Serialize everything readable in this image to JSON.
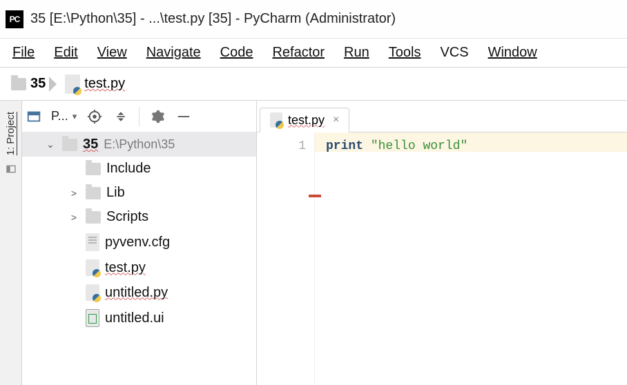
{
  "titlebar": {
    "app_icon_text": "PC",
    "title": "35 [E:\\Python\\35] - ...\\test.py [35] - PyCharm (Administrator)"
  },
  "menu": {
    "file": "File",
    "edit": "Edit",
    "view": "View",
    "navigate": "Navigate",
    "code": "Code",
    "refactor": "Refactor",
    "run": "Run",
    "tools": "Tools",
    "vcs": "VCS",
    "window": "Window"
  },
  "breadcrumb": {
    "root": "35",
    "file": "test.py"
  },
  "sidebar": {
    "label": "1: Project"
  },
  "project_panel": {
    "dropdown_label": "P...",
    "tree": {
      "root": {
        "name": "35",
        "path": "E:\\Python\\35"
      },
      "children": [
        {
          "name": "Include",
          "type": "folder",
          "expand": ""
        },
        {
          "name": "Lib",
          "type": "folder",
          "expand": ">"
        },
        {
          "name": "Scripts",
          "type": "folder",
          "expand": ">"
        },
        {
          "name": "pyvenv.cfg",
          "type": "file"
        },
        {
          "name": "test.py",
          "type": "pyfile"
        },
        {
          "name": "untitled.py",
          "type": "pyfile"
        },
        {
          "name": "untitled.ui",
          "type": "uifile"
        }
      ]
    }
  },
  "editor": {
    "tab": {
      "name": "test.py"
    },
    "gutter": {
      "line1": "1"
    },
    "code": {
      "keyword": "print",
      "string": "\"hello world\""
    }
  }
}
